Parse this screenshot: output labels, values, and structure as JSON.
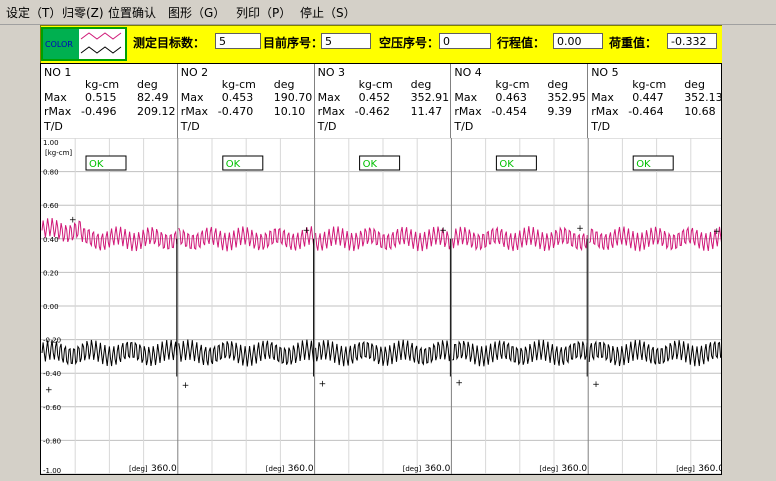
{
  "menu": [
    "设定（T）",
    "归零(Z)",
    "位置确认",
    "图形（G）",
    "列印（P）",
    "停止（S）"
  ],
  "toolbar": {
    "color_label": "COLOR",
    "target_label": "测定目标数：",
    "target_value": "5",
    "current_label": "目前序号：",
    "current_value": "5",
    "empty_label": "空压序号：",
    "empty_value": "0",
    "stroke_label": "行程值：",
    "stroke_value": "0.00",
    "load_label": "荷重值：",
    "load_value": "-0.332"
  },
  "headers": [
    {
      "no": "NO  1",
      "unit1": "kg-cm",
      "unit2": "deg",
      "max_label": "Max",
      "max1": "0.515",
      "max2": "82.49",
      "rmax_label": "rMax",
      "rmax1": "-0.496",
      "rmax2": "209.12",
      "td": "T/D",
      "status": "OK",
      "deg_label": "[deg]",
      "deg_value": "360.0"
    },
    {
      "no": "NO  2",
      "unit1": "kg-cm",
      "unit2": "deg",
      "max_label": "Max",
      "max1": "0.453",
      "max2": "190.70",
      "rmax_label": "rMax",
      "rmax1": "-0.470",
      "rmax2": "10.10",
      "td": "T/D",
      "status": "OK",
      "deg_label": "[deg]",
      "deg_value": "360.0"
    },
    {
      "no": "NO  3",
      "unit1": "kg-cm",
      "unit2": "deg",
      "max_label": "Max",
      "max1": "0.452",
      "max2": "352.91",
      "rmax_label": "rMax",
      "rmax1": "-0.462",
      "rmax2": "11.47",
      "td": "T/D",
      "status": "OK",
      "deg_label": "[deg]",
      "deg_value": "360.0"
    },
    {
      "no": "NO  4",
      "unit1": "kg-cm",
      "unit2": "deg",
      "max_label": "Max",
      "max1": "0.463",
      "max2": "352.95",
      "rmax_label": "rMax",
      "rmax1": "-0.454",
      "rmax2": "9.39",
      "td": "T/D",
      "status": "OK",
      "deg_label": "[deg]",
      "deg_value": "360.0"
    },
    {
      "no": "NO  5",
      "unit1": "kg-cm",
      "unit2": "deg",
      "max_label": "Max",
      "max1": "0.447",
      "max2": "352.13",
      "rmax_label": "rMax",
      "rmax1": "-0.464",
      "rmax2": "10.68",
      "td": "T/D",
      "status": "OK",
      "deg_label": "[deg]",
      "deg_value": "360.0"
    }
  ],
  "y_axis": {
    "unit": "[kg-cm]",
    "ticks": [
      "1.00",
      "0.80",
      "0.60",
      "0.40",
      "0.20",
      "0.00",
      "-0.20",
      "-0.40",
      "-0.60",
      "-0.80",
      "-1.00"
    ]
  },
  "colors": {
    "positive_trace": "#d01878",
    "negative_trace": "#000000"
  }
}
